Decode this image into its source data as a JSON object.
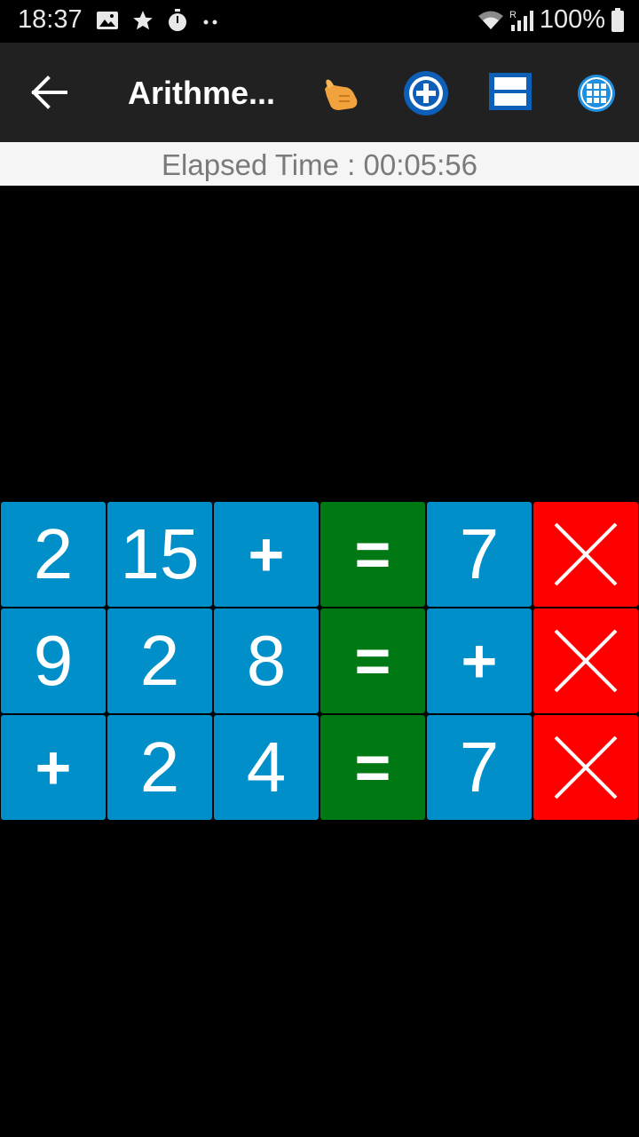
{
  "status_bar": {
    "time": "18:37",
    "battery": "100%",
    "icons": [
      "image-icon",
      "star-icon",
      "timer-icon",
      "dots-icon",
      "wifi-icon",
      "signal-icon",
      "battery-icon"
    ]
  },
  "app_bar": {
    "title": "Arithme...",
    "icons": [
      "back-arrow-icon",
      "hint-hand-icon",
      "add-circle-icon",
      "layout-rows-icon",
      "grid-menu-icon"
    ]
  },
  "elapsed_time": "Elapsed Time : 00:05:56",
  "colors": {
    "tile_blue": "#008fc8",
    "tile_green": "#007813",
    "tile_red": "#ff0000",
    "app_bar": "#212121"
  },
  "grid": {
    "rows": [
      [
        "2",
        "15",
        "+",
        "=",
        "7",
        "✕"
      ],
      [
        "9",
        "2",
        "8",
        "=",
        "+",
        "✕"
      ],
      [
        "+",
        "2",
        "4",
        "=",
        "7",
        "✕"
      ]
    ]
  }
}
